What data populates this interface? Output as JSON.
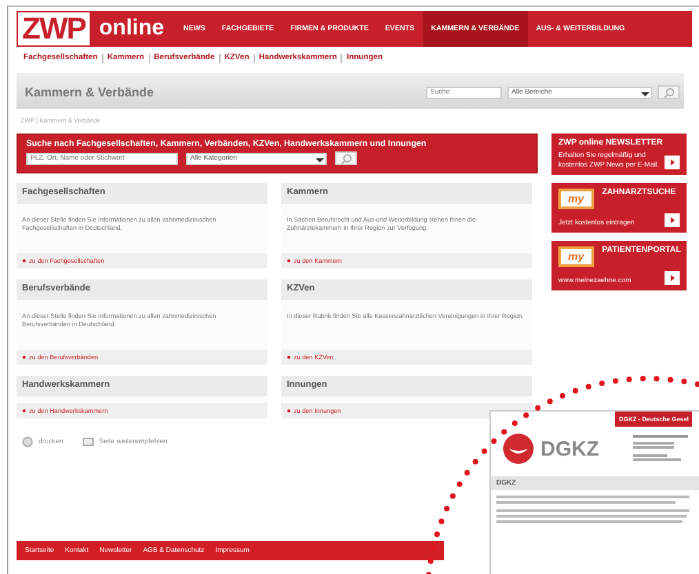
{
  "header": {
    "logo_main": "ZWP",
    "logo_sub": "online",
    "nav": [
      {
        "label": "NEWS",
        "selected": false
      },
      {
        "label": "FACHGEBIETE",
        "selected": false
      },
      {
        "label": "FIRMEN & PRODUKTE",
        "selected": false
      },
      {
        "label": "EVENTS",
        "selected": false
      },
      {
        "label": "KAMMERN & VERBÄNDE",
        "selected": true
      },
      {
        "label": "AUS- & WEITERBILDUNG",
        "selected": false
      }
    ]
  },
  "subnav": [
    "Fachgesellschaften",
    "Kammern",
    "Berufsverbände",
    "KZVen",
    "Handwerkskammern",
    "Innungen"
  ],
  "page_title": "Kammern & Verbände",
  "site_search": {
    "placeholder": "Suche",
    "select": "Alle Bereiche"
  },
  "breadcrumb": "ZWP | Kammern & Verbände",
  "search_panel": {
    "title": "Suche nach Fachgesellschaften, Kammern, Verbänden, KZVen, Handwerkskammern und Innungen",
    "placeholder": "PLZ, Ort, Name oder Stichwort",
    "select": "Alle Kategorien"
  },
  "cards": [
    {
      "title": "Fachgesellschaften",
      "text": "An dieser Stelle finden Sie Informationen zu allen zahnmedizinischen Fachgesellschaften in Deutschland.",
      "link": "zu den Fachgesellschaften"
    },
    {
      "title": "Kammern",
      "text": "In Sachen Berufsrecht und Aus-und Weiterbildung stehen Ihnen die Zahnärztekammern in Ihrer Region zur Verfügung.",
      "link": "zu den Kammern"
    },
    {
      "title": "Berufsverbände",
      "text": "An dieser Stelle finden Sie Informationen zu allen zahnmedizinischen Berufsverbänden in Deutschland.",
      "link": "zu den Berufsverbänden"
    },
    {
      "title": "KZVen",
      "text": "In dieser Rubrik finden Sie alle Kassenzahnärztlichen Vereinigungen in Ihrer Region.",
      "link": "zu den KZVen"
    },
    {
      "title": "Handwerkskammern",
      "link": "zu den Handwerkskammern"
    },
    {
      "title": "Innungen",
      "link": "zu den Innungen"
    }
  ],
  "sidebar": [
    {
      "kind": "newsletter",
      "title": "ZWP online NEWSLETTER",
      "text": "Erhalten Sie regelmäßig und kostenlos ZWP News per E-Mail."
    },
    {
      "kind": "promo",
      "badge": "my",
      "title": "ZAHNARZTSUCHE",
      "text": "Jetzt kostenlos eintragen"
    },
    {
      "kind": "promo",
      "badge": "my",
      "title": "PATIENTENPORTAL",
      "text": "www.meinezaehne.com"
    }
  ],
  "tools": [
    {
      "kind": "print",
      "label": "drucken"
    },
    {
      "kind": "recommend",
      "label": "Seite weiterempfehlen"
    }
  ],
  "footer": [
    "Startseite",
    "Kontakt",
    "Newsletter",
    "AGB & Datenschutz",
    "Impressum"
  ],
  "inset": {
    "header": "DGKZ - Deutsche Gesel",
    "logo": "DGKZ",
    "section": "DGKZ"
  }
}
